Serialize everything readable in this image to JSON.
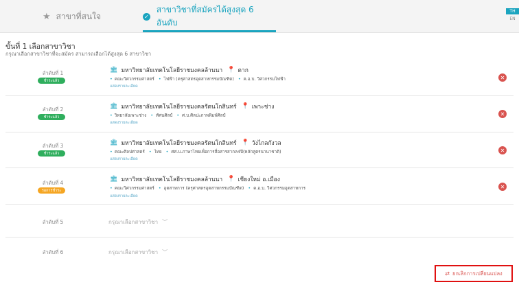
{
  "tabs": {
    "favorites_label": "สาขาที่สนใจ",
    "chosen_label": "สาขาวิชาที่สมัครได้สูงสุด 6 อันดับ"
  },
  "lang": {
    "th": "TH",
    "en": "EN"
  },
  "step": {
    "title": "ขั้นที่ 1 เลือกสาขาวิชา",
    "subtitle": "กรุณาเลือกสาขาวิชาที่จะสมัคร สามารถเลือกได้สูงสุด 6 สาขาวิชา"
  },
  "choices": [
    {
      "rank": "ลำดับที่ 1",
      "status": "ชำระแล้ว",
      "status_color": "#2fae5d",
      "university": "มหาวิทยาลัยเทคโนโลยีราชมงคลล้านนา",
      "campus": "ตาก",
      "faculty": "คณะวิศวกรรมศาสตร์",
      "field": "ไฟฟ้า (ครุศาสตรอุตสาหกรรมบัณฑิต)",
      "program": "ค.อ.บ. วิศวกรรมไฟฟ้า",
      "detail": "แสดงรายละเอียด"
    },
    {
      "rank": "ลำดับที่ 2",
      "status": "ชำระแล้ว",
      "status_color": "#2fae5d",
      "university": "มหาวิทยาลัยเทคโนโลยีราชมงคลรัตนโกสินทร์",
      "campus": "เพาะช่าง",
      "faculty": "วิทยาลัยเพาะช่าง",
      "field": "ทัศนศิลป์",
      "program": "ศ.บ.ศิลปะภาพพิมพ์ศิลป์",
      "detail": "แสดงรายละเอียด"
    },
    {
      "rank": "ลำดับที่ 3",
      "status": "ชำระแล้ว",
      "status_color": "#2fae5d",
      "university": "มหาวิทยาลัยเทคโนโลยีราชมงคลรัตนโกสินทร์",
      "campus": "วังไกลกังวล",
      "faculty": "คณะศิลปศาสตร์",
      "field": "ไทย",
      "program": "ศศ.บ.ภาษาไทยเพื่อการสื่อสารสากล4ปี(หลักสูตรนานาชาติ)",
      "detail": "แสดงรายละเอียด"
    },
    {
      "rank": "ลำดับที่ 4",
      "status": "รอการชำระ",
      "status_color": "#f5a623",
      "university": "มหาวิทยาลัยเทคโนโลยีราชมงคลล้านนา",
      "campus": "เชียงใหม่ อ.เมือง",
      "faculty": "คณะวิศวกรรมศาสตร์",
      "field": "อุตสาหการ (ครุศาสตรอุตสาหกรรมบัณฑิต)",
      "program": "ค.อ.บ. วิศวกรรมอุตสาหการ",
      "detail": "แสดงรายละเอียด"
    }
  ],
  "empty_slots": [
    {
      "rank": "ลำดับที่ 5",
      "placeholder": "กรุณาเลือกสาขาวิชา"
    },
    {
      "rank": "ลำดับที่ 6",
      "placeholder": "กรุณาเลือกสาขาวิชา"
    }
  ],
  "cancel_label": "ยกเลิกการเปลี่ยนแปลง",
  "icons": {
    "star": "star-icon",
    "check": "check-circle-icon",
    "university": "university-icon",
    "location": "map-pin-icon",
    "remove": "remove-circle-icon",
    "chevron": "chevron-down-icon",
    "undo": "undo-icon"
  },
  "colors": {
    "accent": "#1aa4bf",
    "paid": "#2fae5d",
    "pending": "#f5a623",
    "remove": "#d9534f",
    "highlight": "#e01010"
  }
}
